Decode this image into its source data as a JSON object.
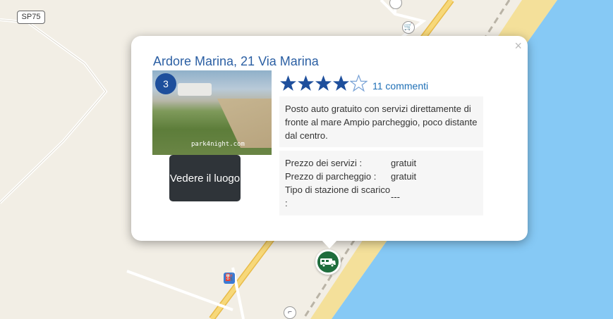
{
  "map": {
    "road_label": "SP75",
    "land_color": "#f2eee5",
    "sea_color": "#86c9f5",
    "marker_icon": "camper-van-icon",
    "fuel_icon": "fuel-station-icon",
    "shop_icon": "shopping-basket-icon"
  },
  "popup": {
    "title": "Ardore Marina, 21 Via Marina",
    "close_label": "×",
    "photo_count": "3",
    "photo_watermark": "park4night.com",
    "visit_button": "Vedere il luogo",
    "rating": 4,
    "rating_max": 5,
    "comments_link": "11 commenti",
    "description": "Posto auto gratuito con servizi direttamente di fronte al mare Ampio parcheggio, poco distante dal centro.",
    "details": [
      {
        "label": "Prezzo dei servizi :",
        "value": "gratuit"
      },
      {
        "label": "Prezzo di parcheggio :",
        "value": "gratuit"
      },
      {
        "label": "Tipo di stazione di scarico :",
        "value": "---"
      }
    ]
  }
}
